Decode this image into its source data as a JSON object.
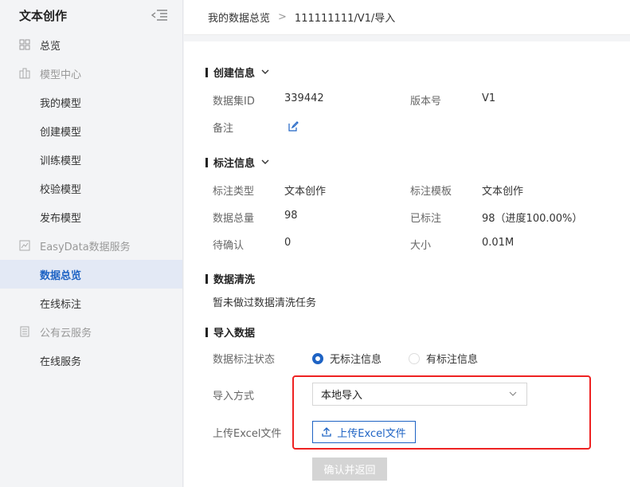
{
  "sidebar": {
    "title": "文本创作",
    "items": [
      {
        "label": "总览",
        "kind": "top",
        "icon": "grid-icon"
      },
      {
        "label": "模型中心",
        "kind": "group",
        "icon": "cube-icon"
      },
      {
        "label": "我的模型",
        "kind": "sub"
      },
      {
        "label": "创建模型",
        "kind": "sub"
      },
      {
        "label": "训练模型",
        "kind": "sub"
      },
      {
        "label": "校验模型",
        "kind": "sub"
      },
      {
        "label": "发布模型",
        "kind": "sub"
      },
      {
        "label": "EasyData数据服务",
        "kind": "group",
        "icon": "chart-icon"
      },
      {
        "label": "数据总览",
        "kind": "sub",
        "active": true
      },
      {
        "label": "在线标注",
        "kind": "sub"
      },
      {
        "label": "公有云服务",
        "kind": "group",
        "icon": "server-icon"
      },
      {
        "label": "在线服务",
        "kind": "sub"
      }
    ]
  },
  "breadcrumb": {
    "home": "我的数据总览",
    "separator": ">",
    "current": "111111111/V1/导入"
  },
  "create_info": {
    "title": "创建信息",
    "dataset_id_label": "数据集ID",
    "dataset_id": "339442",
    "version_label": "版本号",
    "version": "V1",
    "note_label": "备注"
  },
  "annotation_info": {
    "title": "标注信息",
    "type_label": "标注类型",
    "type": "文本创作",
    "template_label": "标注模板",
    "template": "文本创作",
    "total_label": "数据总量",
    "total": "98",
    "labeled_label": "已标注",
    "labeled": "98（进度100.00%）",
    "pending_label": "待确认",
    "pending": "0",
    "size_label": "大小",
    "size": "0.01M"
  },
  "cleaning": {
    "title": "数据清洗",
    "text": "暂未做过数据清洗任务"
  },
  "import": {
    "title": "导入数据",
    "status_label": "数据标注状态",
    "option_none": "无标注信息",
    "option_with": "有标注信息",
    "method_label": "导入方式",
    "method_value": "本地导入",
    "upload_label": "上传Excel文件",
    "upload_button": "上传Excel文件",
    "confirm_button": "确认并返回"
  },
  "colors": {
    "accent": "#1e63c4",
    "highlight": "#e22222",
    "active_bg": "#e3e9f5"
  }
}
